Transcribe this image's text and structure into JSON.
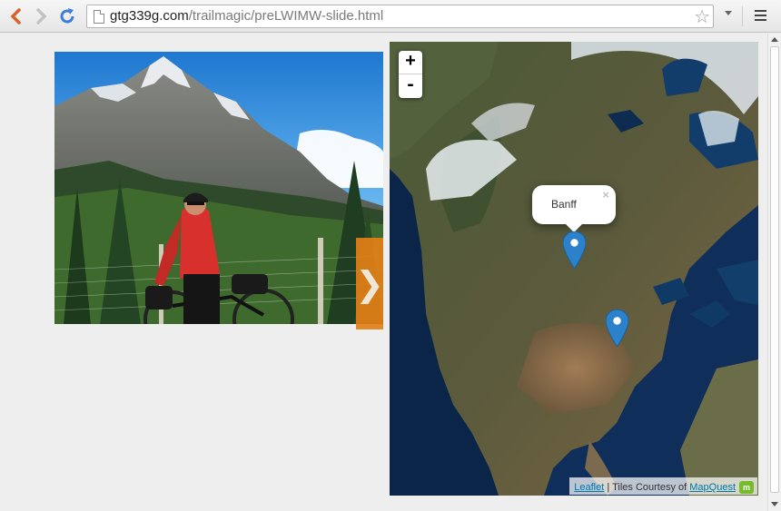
{
  "browser": {
    "url_domain": "gtg339g.com",
    "url_path": "/trailmagic/preLWIMW-slide.html"
  },
  "map": {
    "zoom_in_label": "+",
    "zoom_out_label": "-",
    "popup": {
      "text": "Banff",
      "close_label": "×"
    },
    "attribution": {
      "leaflet_label": "Leaflet",
      "separator": " | Tiles Courtesy of ",
      "mapquest_label": "MapQuest"
    },
    "colors": {
      "marker": "#2b82cb",
      "ocean": "#10325e"
    }
  },
  "slideshow": {
    "next_icon": "chevron-right-icon",
    "next_glyph": "❯",
    "accent": "#e38018"
  }
}
